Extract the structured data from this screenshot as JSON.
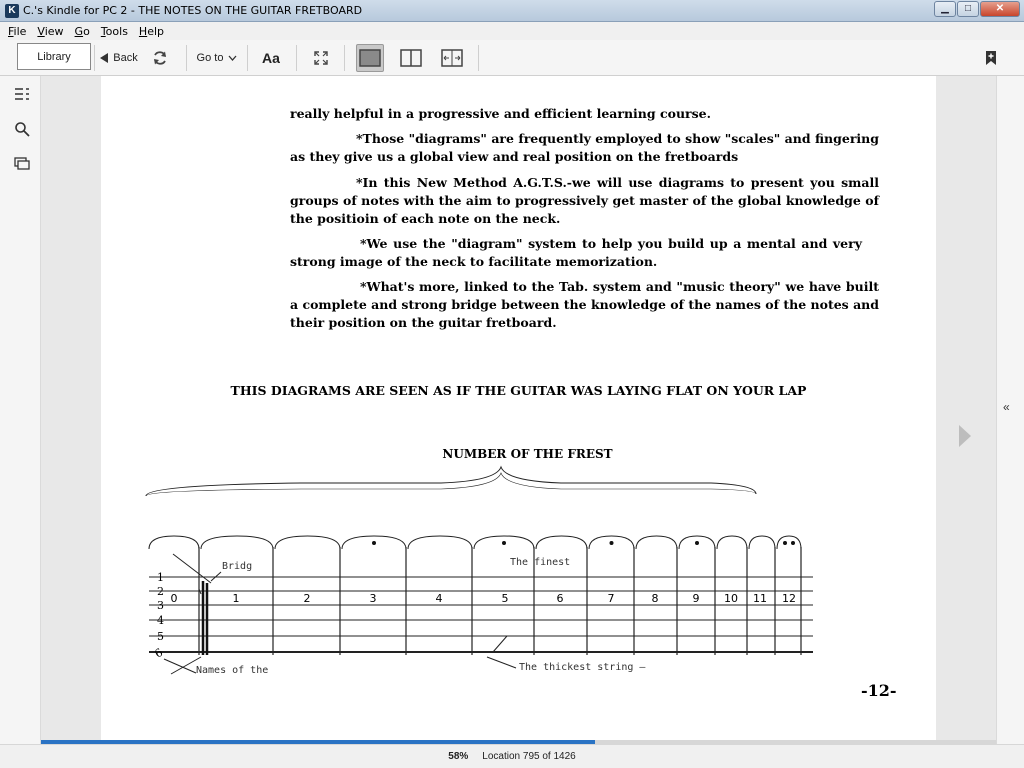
{
  "window": {
    "title": "C.'s Kindle for PC 2 - THE NOTES ON THE GUITAR FRETBOARD",
    "minimize": "▁",
    "maximize": "□",
    "close": "✕"
  },
  "menu": {
    "items": [
      {
        "label": "File",
        "key": "F"
      },
      {
        "label": "View",
        "key": "V"
      },
      {
        "label": "Go",
        "key": "G"
      },
      {
        "label": "Tools",
        "key": "T"
      },
      {
        "label": "Help",
        "key": "H"
      }
    ]
  },
  "toolbar": {
    "library_label": "Library",
    "back_label": "Back",
    "goto_label": "Go to",
    "font_label": "Aa"
  },
  "page": {
    "paragraphs": [
      "really helpful in a progressive and efficient learning course.",
      "*Those \"diagrams\" are frequently employed to show \"scales\" and fingering as they give us a global view and real position on the fretboards",
      "*In this New Method A.G.T.S.-we will use diagrams to present you small groups of notes with the aim to progressively get master of the global knowledge of the positioin of each note on the neck.",
      "*We use the \"diagram\" system to help you build up a mental and very strong image of the neck to facilitate memorization.",
      "*What's more, linked to the Tab. system and \"music theory\" we have built a complete and strong bridge between the knowledge of the names of the notes and their position on the guitar fretboard."
    ],
    "heading": "THIS DIAGRAMS ARE SEEN AS IF THE GUITAR WAS LAYING FLAT ON YOUR LAP",
    "page_number": "-12-"
  },
  "diagram": {
    "title": "NUMBER OF THE FREST",
    "fret_numbers": [
      "0",
      "1",
      "2",
      "3",
      "4",
      "5",
      "6",
      "7",
      "8",
      "9",
      "10",
      "11",
      "12"
    ],
    "string_numbers": [
      "1",
      "2",
      "3",
      "4",
      "5",
      "6"
    ],
    "labels": {
      "bridge": "Bridg",
      "finest": "The finest",
      "names": "Names of the",
      "thickest": "The thickest string —"
    }
  },
  "status": {
    "percent": "58%",
    "location": "Location 795 of 1426",
    "progress_fraction": 0.58
  },
  "colors": {
    "progress": "#2a73c4",
    "titlebar": "#b7c9dc"
  }
}
